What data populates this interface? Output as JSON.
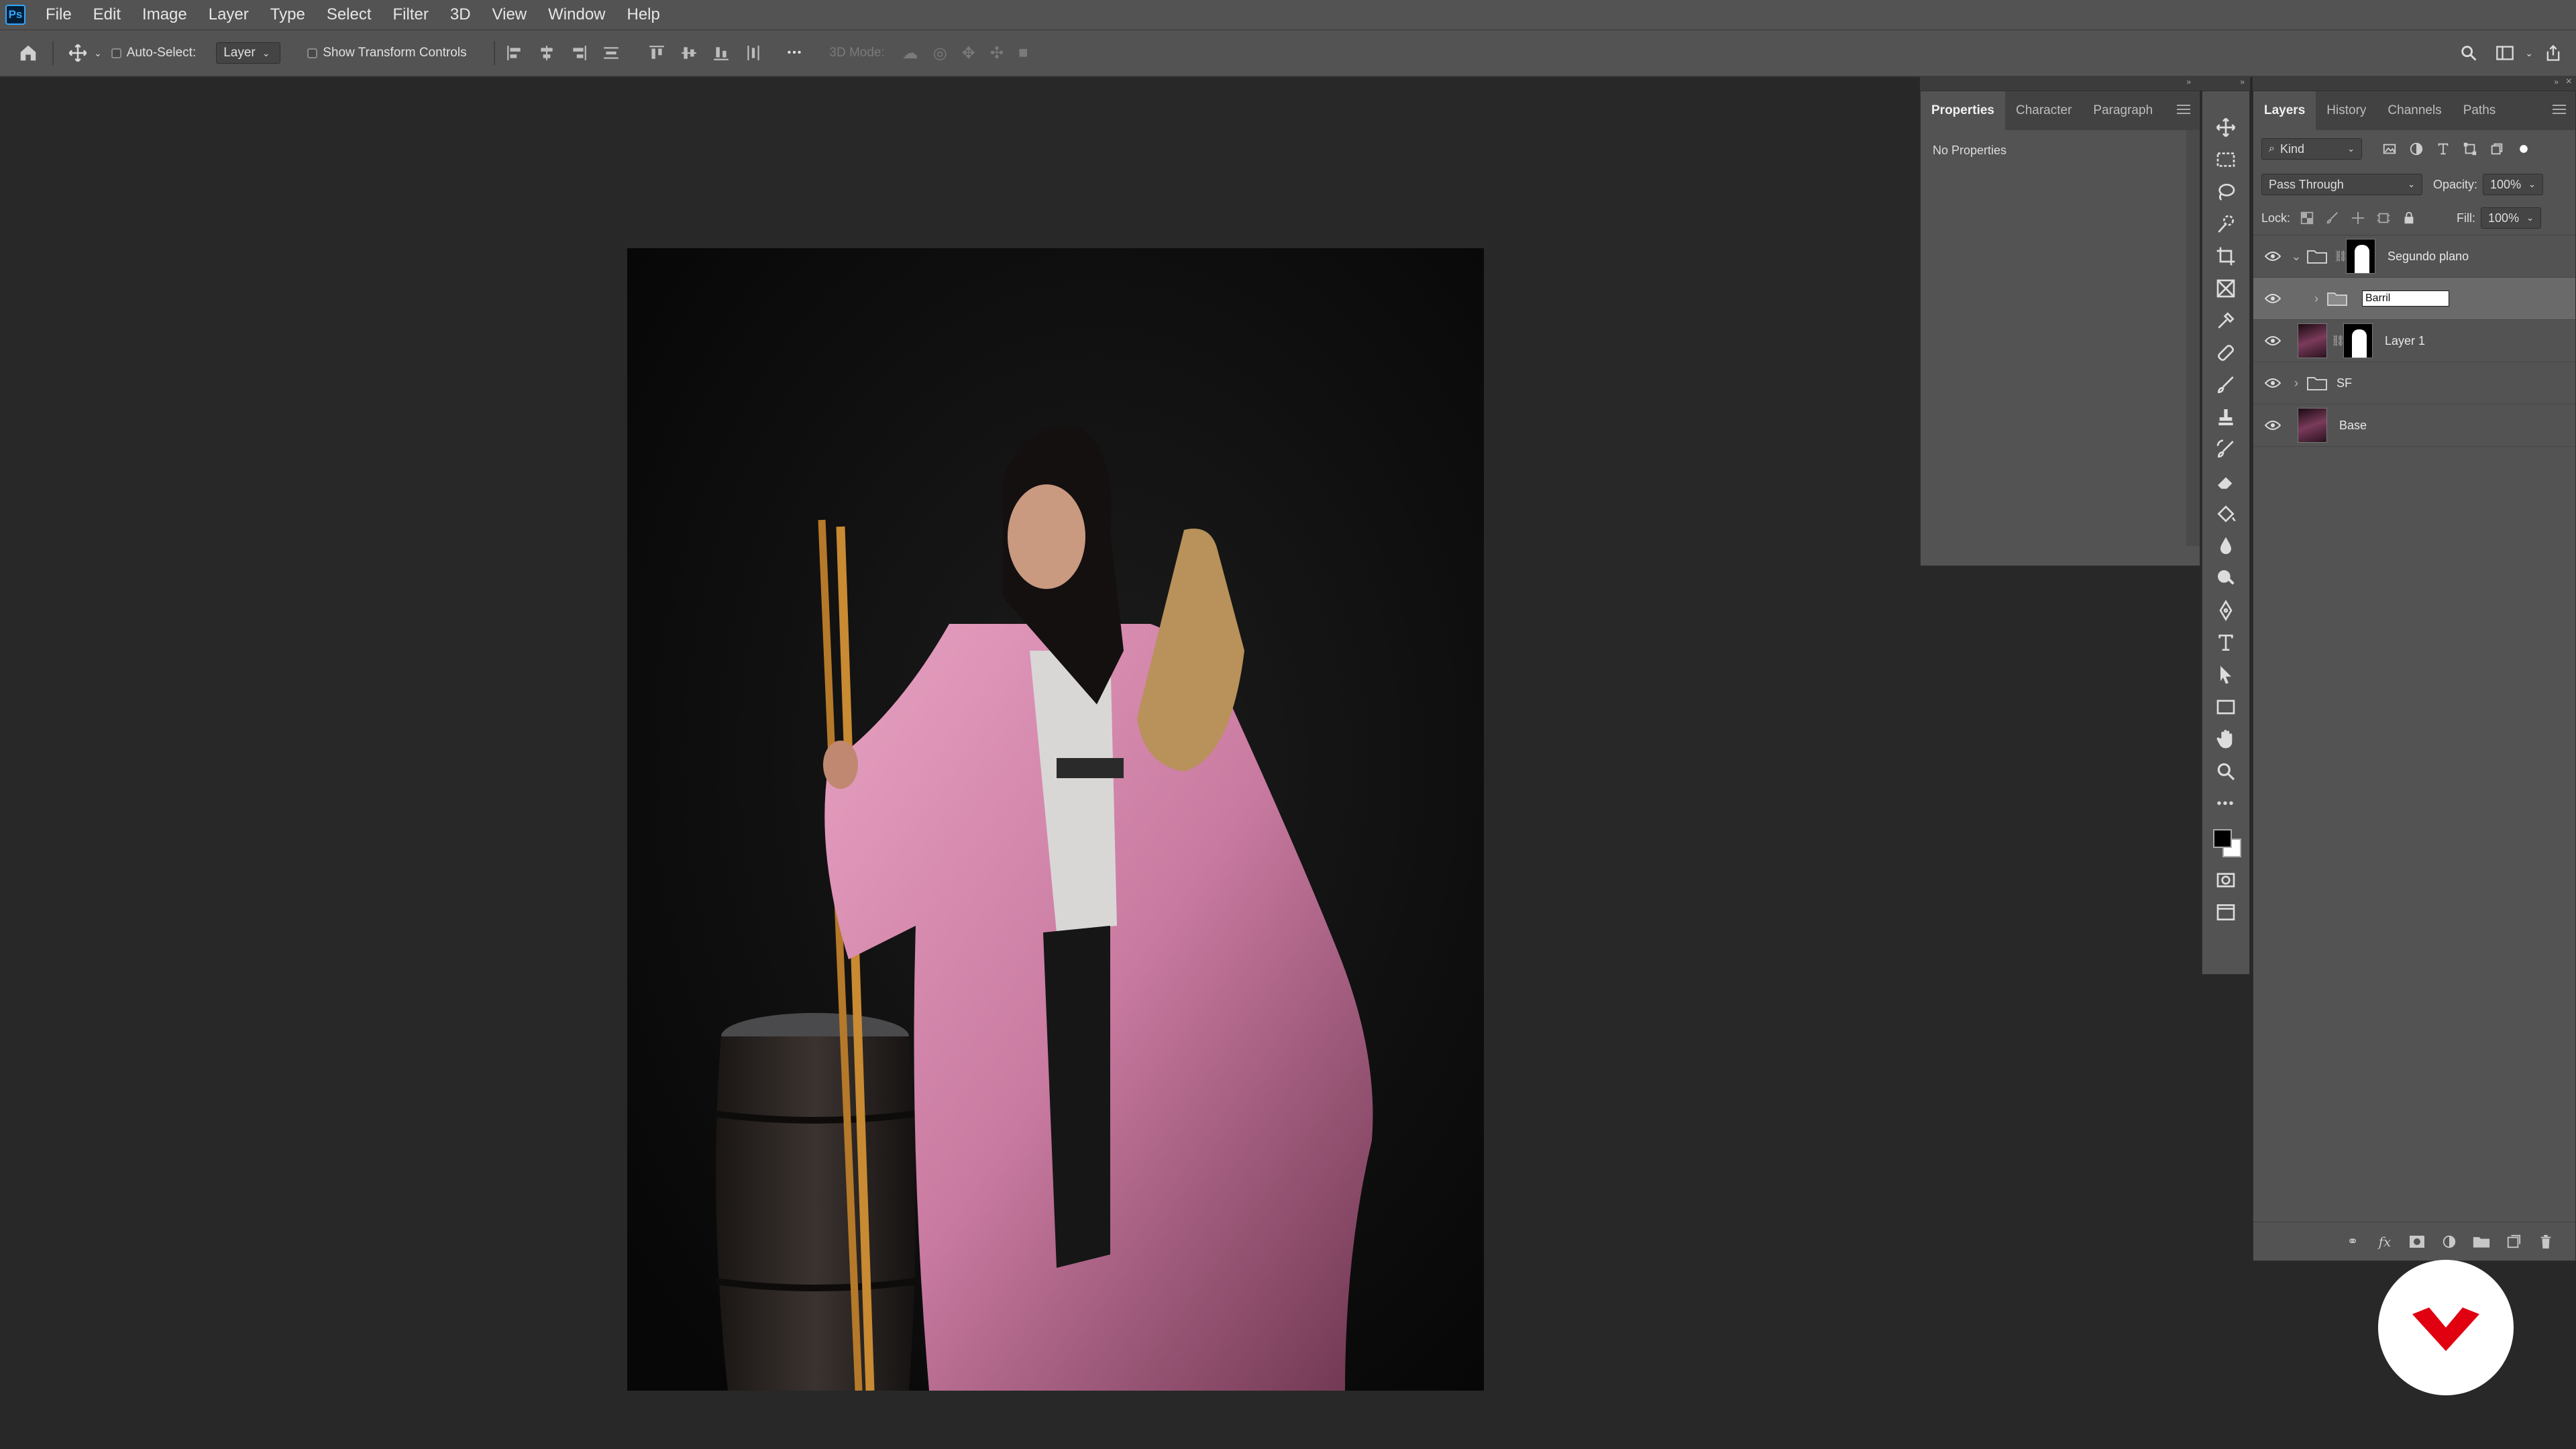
{
  "app": {
    "logo": "Ps"
  },
  "menu": [
    "File",
    "Edit",
    "Image",
    "Layer",
    "Type",
    "Select",
    "Filter",
    "3D",
    "View",
    "Window",
    "Help"
  ],
  "options_bar": {
    "auto_select_label": "Auto-Select:",
    "auto_select_target": "Layer",
    "show_transform_label": "Show Transform Controls",
    "mode_label": "3D Mode:",
    "more": "•••"
  },
  "properties_panel": {
    "tabs": [
      "Properties",
      "Character",
      "Paragraph"
    ],
    "content": "No Properties"
  },
  "layers_panel": {
    "tabs": [
      "Layers",
      "History",
      "Channels",
      "Paths"
    ],
    "filter_kind": "Kind",
    "blend_mode": "Pass Through",
    "opacity_label": "Opacity:",
    "opacity_value": "100%",
    "lock_label": "Lock:",
    "fill_label": "Fill:",
    "fill_value": "100%",
    "layers": [
      {
        "name": "Segundo plano"
      },
      {
        "name": "Barril"
      },
      {
        "name": "Layer 1"
      },
      {
        "name": "SF"
      },
      {
        "name": "Base"
      }
    ]
  },
  "colors": {
    "accent": "#31a8ff",
    "foreground": "#000000",
    "background": "#ffffff",
    "brand": "#e00010"
  },
  "icons": [
    "home-icon",
    "move-icon",
    "search-icon",
    "workspace-icon",
    "share-icon"
  ]
}
